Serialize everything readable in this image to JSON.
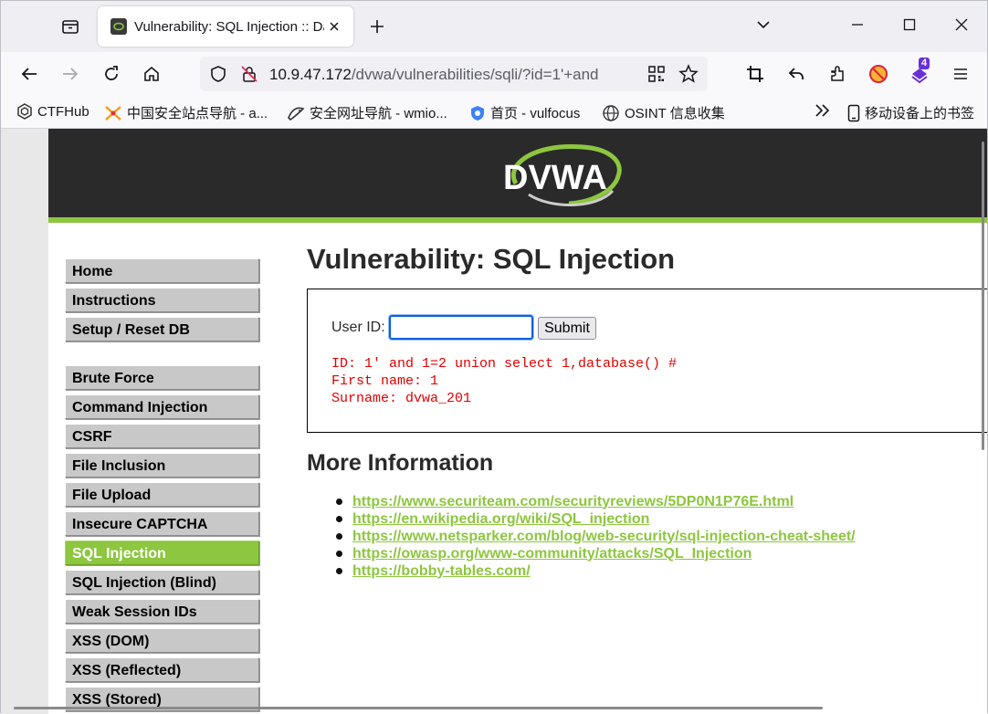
{
  "browser": {
    "tab": {
      "title": "Vulnerability: SQL Injection :: Damn"
    },
    "url": {
      "host": "10.9.47.172",
      "path": "/dvwa/vulnerabilities/sqli/?id=1'+and"
    },
    "extension_badge": "4",
    "bookmarks": [
      {
        "label": "CTFHub",
        "icon": "ctfhub-icon"
      },
      {
        "label": "中国安全站点导航 - a...",
        "icon": "sword-icon"
      },
      {
        "label": "安全网址导航 - wmio...",
        "icon": "fish-icon"
      },
      {
        "label": "首页 - vulfocus",
        "icon": "shield-gear-icon"
      },
      {
        "label": "OSINT 信息收集",
        "icon": "globe-icon"
      }
    ],
    "mobile_bookmarks": "移动设备上的书签"
  },
  "header": {
    "logo_text": "DVWA",
    "accent": "#8dc63f"
  },
  "menu": {
    "items": [
      "Home",
      "Instructions",
      "Setup / Reset DB",
      "Brute Force",
      "Command Injection",
      "CSRF",
      "File Inclusion",
      "File Upload",
      "Insecure CAPTCHA",
      "SQL Injection",
      "SQL Injection (Blind)",
      "Weak Session IDs",
      "XSS (DOM)",
      "XSS (Reflected)",
      "XSS (Stored)"
    ],
    "active": "SQL Injection"
  },
  "main": {
    "title": "Vulnerability: SQL Injection",
    "form": {
      "label": "User ID:",
      "value": "",
      "submit": "Submit"
    },
    "result": {
      "line1": "ID: 1' and 1=2 union select 1,database() #",
      "line2": "First name: 1",
      "line3": "Surname: dvwa_201"
    },
    "more_title": "More Information",
    "links": [
      "https://www.securiteam.com/securityreviews/5DP0N1P76E.html",
      "https://en.wikipedia.org/wiki/SQL_injection",
      "https://www.netsparker.com/blog/web-security/sql-injection-cheat-sheet/",
      "https://owasp.org/www-community/attacks/SQL_Injection",
      "https://bobby-tables.com/"
    ]
  }
}
